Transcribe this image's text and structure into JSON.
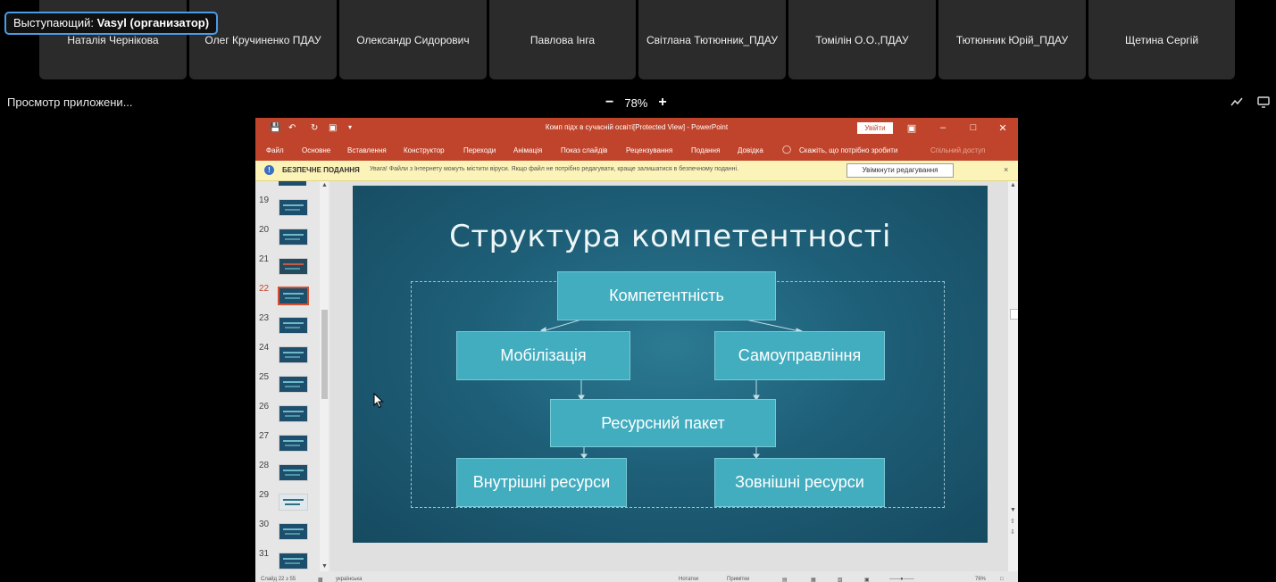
{
  "speaker": {
    "label": "Выступающий: ",
    "name": "Vasyl (организатор)"
  },
  "participants": [
    "Наталія Чернікова",
    "Олег Кручиненко ПДАУ",
    "Олександр Сидорович",
    "Павлова Інга",
    "Світлана Тютюнник_ПДАУ",
    "Томілін О.О.,ПДАУ",
    "Тютюнник Юрій_ПДАУ",
    "Щетина Сергій"
  ],
  "share": {
    "title": "Просмотр приложени...",
    "zoom_minus": "−",
    "zoom_value": "78%",
    "zoom_plus": "+",
    "icons": [
      "annotate-icon",
      "share-screen-icon"
    ]
  },
  "ppt": {
    "window_title": "Комп підх в сучасній освіті[Protected View]  -  PowerPoint",
    "login": "Увійти",
    "menu": [
      "Файл",
      "Основне",
      "Вставлення",
      "Конструктор",
      "Переходи",
      "Анімація",
      "Показ слайдів",
      "Рецензування",
      "Подання",
      "Довідка",
      "Скажіть, що потрібно зробити",
      "Спільний доступ"
    ],
    "protected": {
      "label": "БЕЗПЕЧНЕ ПОДАННЯ",
      "message": "Увага! Файли з Інтернету можуть містити віруси. Якщо файл не потрібно редагувати, краще залишатися в безпечному поданні.",
      "enable_button": "Увімкнути редагування",
      "close": "×"
    },
    "thumbnails": [
      "19",
      "20",
      "21",
      "22",
      "23",
      "24",
      "25",
      "26",
      "27",
      "28",
      "29",
      "30",
      "31"
    ],
    "selected_slide": "22",
    "slide": {
      "title": "Структура компетентності",
      "boxes": {
        "top": "Компетентність",
        "left": "Мобілізація",
        "right": "Самоуправління",
        "middle": "Ресурсний пакет",
        "bottom_left": "Внутрішні ресурси",
        "bottom_right": "Зовнішні ресурси"
      }
    },
    "status": {
      "slide": "Слайд 22 з 55",
      "lang": "українська",
      "notes": "Нотатки",
      "comments": "Примітки",
      "zoom": "76%"
    }
  }
}
